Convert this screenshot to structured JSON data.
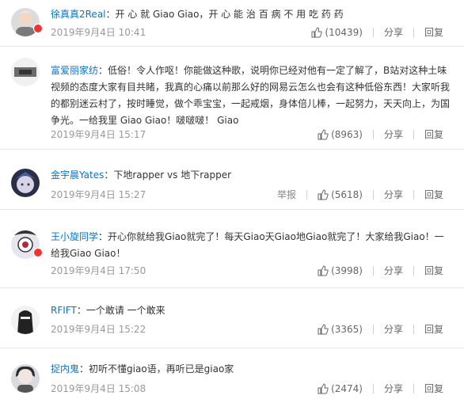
{
  "comments": [
    {
      "user": "徐真真2Real",
      "text": "：开 心 就 Giao Giao，开 心 能 治 百 病 不 用 吃 药 药",
      "time": "2019年9月4日 10:41",
      "likes": "(10439)",
      "has_badge": true,
      "avatar_color": "#c9c9c9"
    },
    {
      "user": "富爱丽家纺",
      "text": "：低俗！令人作呕！你能做这种歌，说明你已经对他有一定了解了，B站对这种土味视频的态度大家有目共睹，我真的心痛以前那么好的网易云怎么也会有这种低俗东西！大家听我的都别迷云村了，按时睡觉，做个乖宝宝，一起戒烟，身体倍儿棒，一起努力，天天向上，为国争光。一给我里 Giao Giao！啵啵啵！ Giao",
      "time": "2019年9月4日 15:17",
      "likes": "(8963)",
      "has_badge": false,
      "avatar_color": "#9a9a9a"
    },
    {
      "user": "金宇晨Yates",
      "text": "：下地rapper vs 地下rapper",
      "time": "2019年9月4日 15:27",
      "likes": "(5618)",
      "report": "举报",
      "has_badge": false,
      "avatar_color": "#2f3550"
    },
    {
      "user": "王小旋同学",
      "text": "：开心你就给我Giao就完了！每天Giao天Giao地Giao就完了！大家给我Giao！一给我Giao Giao！",
      "time": "2019年9月4日 17:50",
      "likes": "(3998)",
      "has_badge": true,
      "avatar_color": "#b9b9c6"
    },
    {
      "user": "RFIFT",
      "text": "：一个敢请 一个敢来",
      "time": "2019年9月4日 15:22",
      "likes": "(3365)",
      "has_badge": false,
      "avatar_color": "#3a3a3a"
    },
    {
      "user": "捉内鬼",
      "text": "：初听不懂giao语，再听已是giao家",
      "time": "2019年9月4日 15:08",
      "likes": "(2474)",
      "has_badge": false,
      "avatar_color": "#8d8d96"
    }
  ],
  "labels": {
    "share": "分享",
    "reply": "回复"
  },
  "icons": {
    "like": "thumbs-up-icon"
  }
}
